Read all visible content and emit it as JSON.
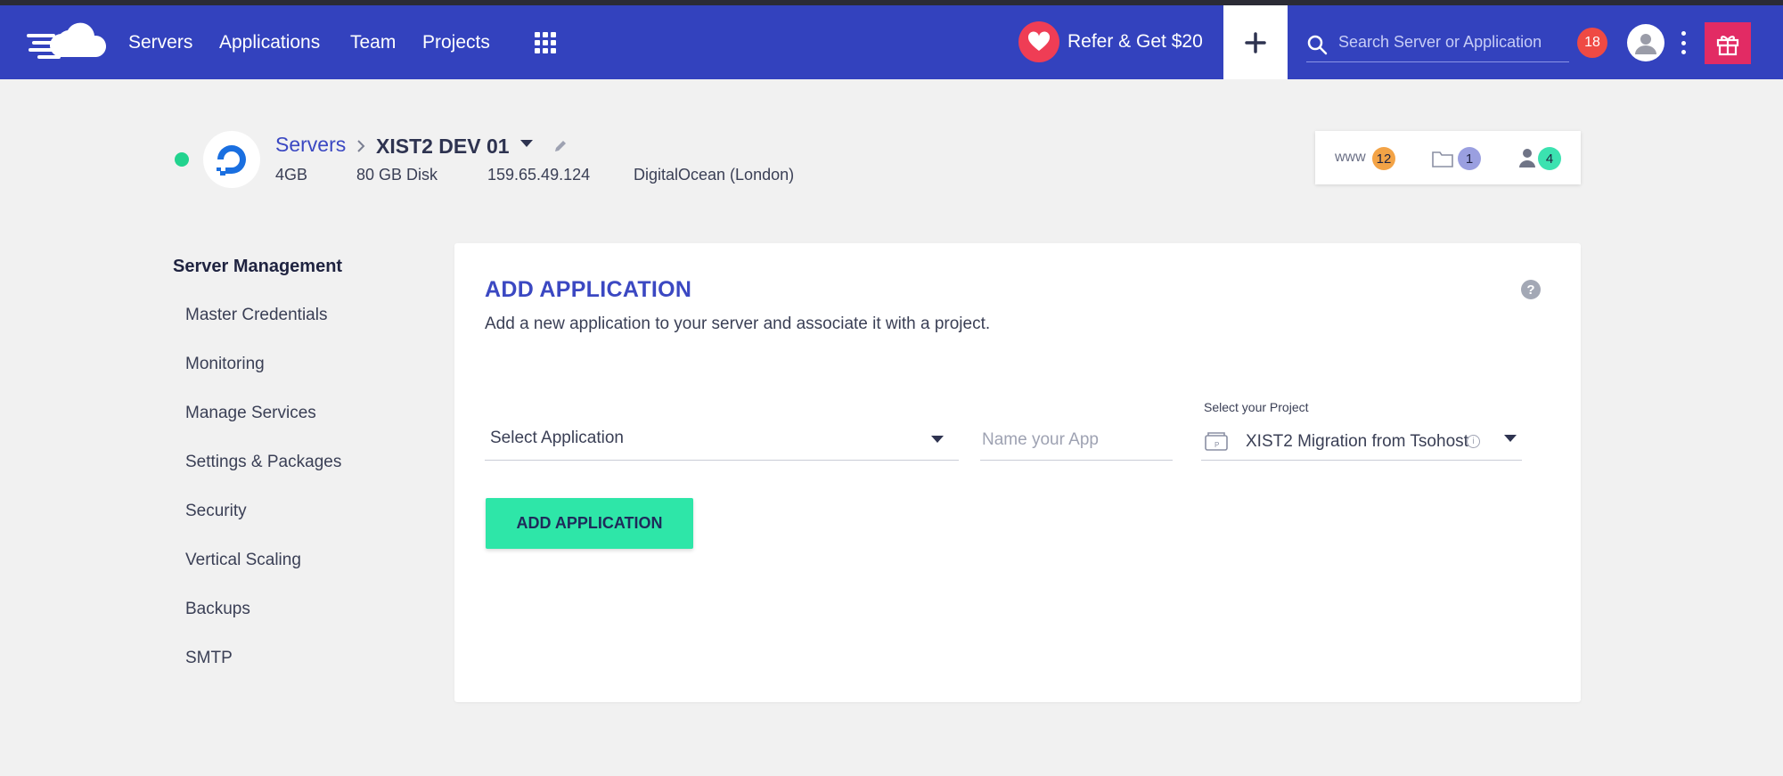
{
  "nav": {
    "links": [
      "Servers",
      "Applications",
      "Team",
      "Projects"
    ],
    "refer_label": "Refer & Get $20",
    "search_placeholder": "Search Server or Application",
    "notifications_count": "18"
  },
  "server": {
    "breadcrumb_root": "Servers",
    "name": "XIST2 DEV 01",
    "memory": "4GB",
    "disk": "80 GB Disk",
    "ip": "159.65.49.124",
    "provider": "DigitalOcean (London)",
    "status_color": "#22d38e"
  },
  "stats": {
    "www_label": "www",
    "apps_count": "12",
    "projects_count": "1",
    "users_count": "4"
  },
  "sidebar": {
    "title": "Server Management",
    "items": [
      "Master Credentials",
      "Monitoring",
      "Manage Services",
      "Settings & Packages",
      "Security",
      "Vertical Scaling",
      "Backups",
      "SMTP"
    ]
  },
  "card": {
    "title": "ADD APPLICATION",
    "description": "Add a new application to your server and associate it with a project.",
    "help": "?",
    "select_application": "Select Application",
    "name_placeholder": "Name your App",
    "project_label": "Select your Project",
    "project_value": "XIST2 Migration from Tsohost",
    "add_button": "ADD APPLICATION"
  },
  "colors": {
    "navbar": "#3342be",
    "accent_button": "#2ee6a8",
    "gift": "#e22b64",
    "refer_heart": "#ef3d55"
  }
}
